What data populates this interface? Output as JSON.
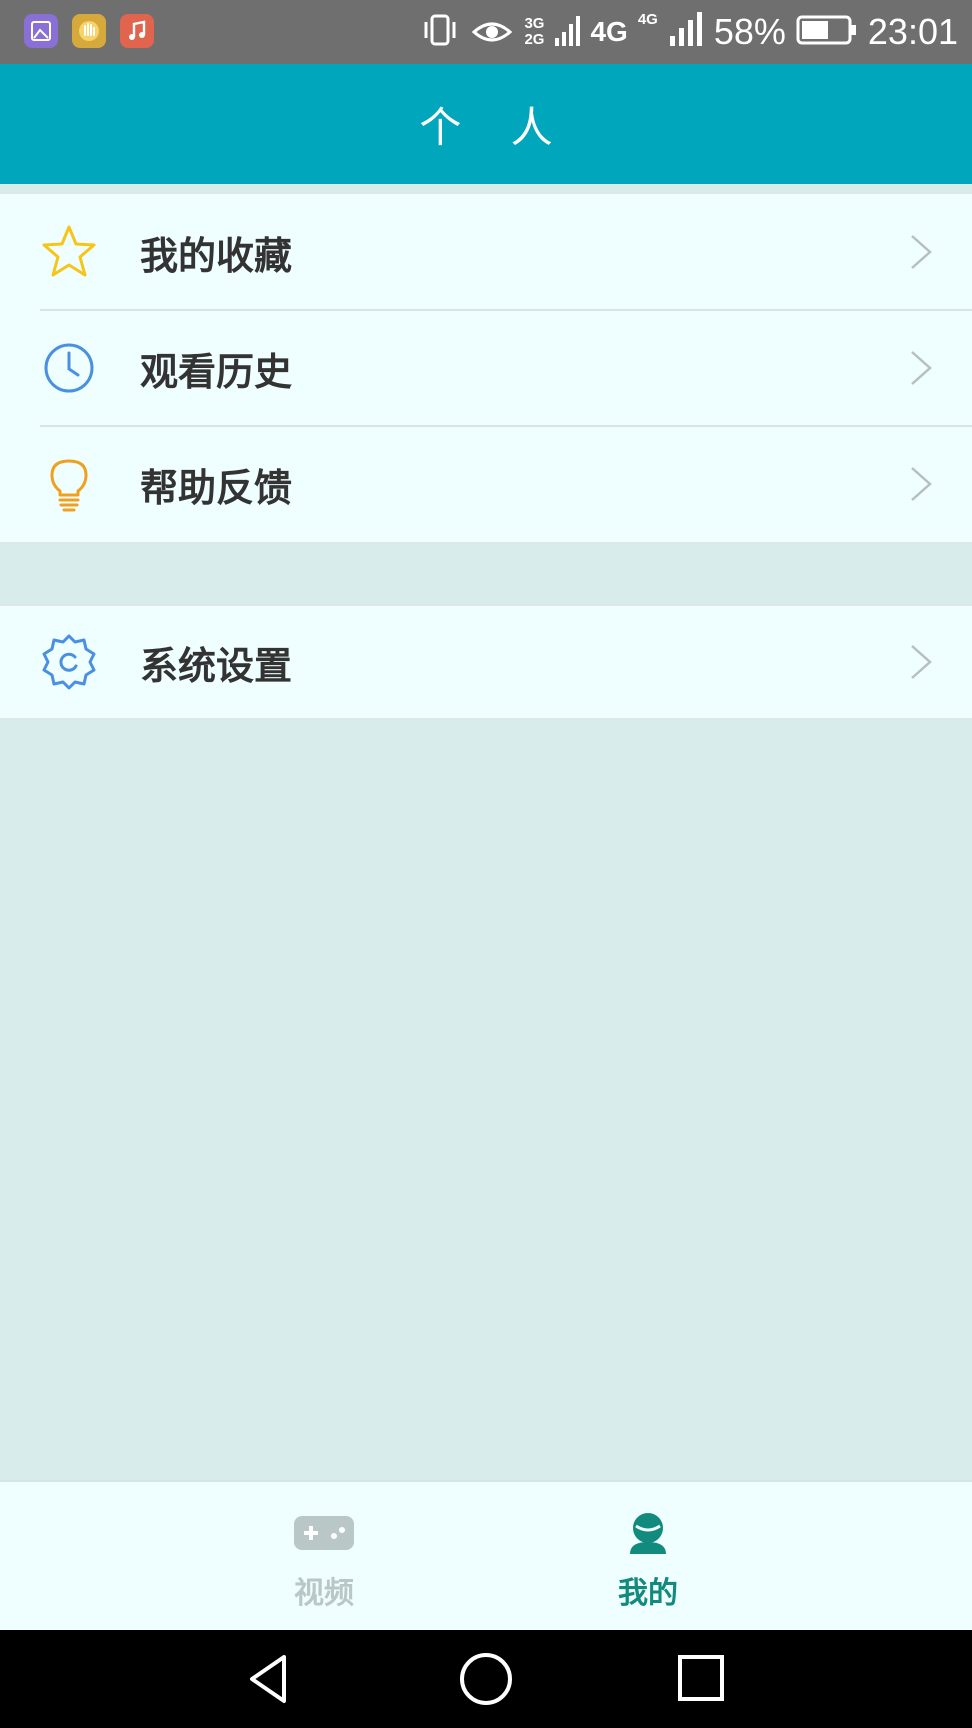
{
  "status_bar": {
    "signal_3g": "3G",
    "signal_2g": "2G",
    "signal_4g_left": "4G",
    "signal_4g_right": "4G",
    "battery_percent": "58%",
    "time": "23:01",
    "app_icons": [
      "gallery-icon",
      "hand-icon",
      "music-icon"
    ]
  },
  "header": {
    "title": "个 人"
  },
  "menu": {
    "group1": [
      {
        "label": "我的收藏",
        "icon": "star-icon",
        "color": "#f5c518"
      },
      {
        "label": "观看历史",
        "icon": "clock-icon",
        "color": "#4a90e2"
      },
      {
        "label": "帮助反馈",
        "icon": "lightbulb-icon",
        "color": "#f0a020"
      }
    ],
    "group2": [
      {
        "label": "系统设置",
        "icon": "gear-icon",
        "color": "#4a90e2"
      }
    ]
  },
  "tabs": [
    {
      "label": "视频",
      "icon": "gamepad-icon",
      "active": false,
      "color": "#b9c7c7"
    },
    {
      "label": "我的",
      "icon": "user-icon",
      "active": true,
      "color": "#128a7e"
    }
  ],
  "nav_bar": {
    "buttons": [
      "back-icon",
      "home-icon",
      "recents-icon"
    ]
  },
  "colors": {
    "header_bg": "#00a6bb",
    "page_bg": "#d8eceb",
    "list_bg": "#effefe",
    "active_tab": "#128a7e",
    "inactive_tab": "#b9c7c7"
  }
}
